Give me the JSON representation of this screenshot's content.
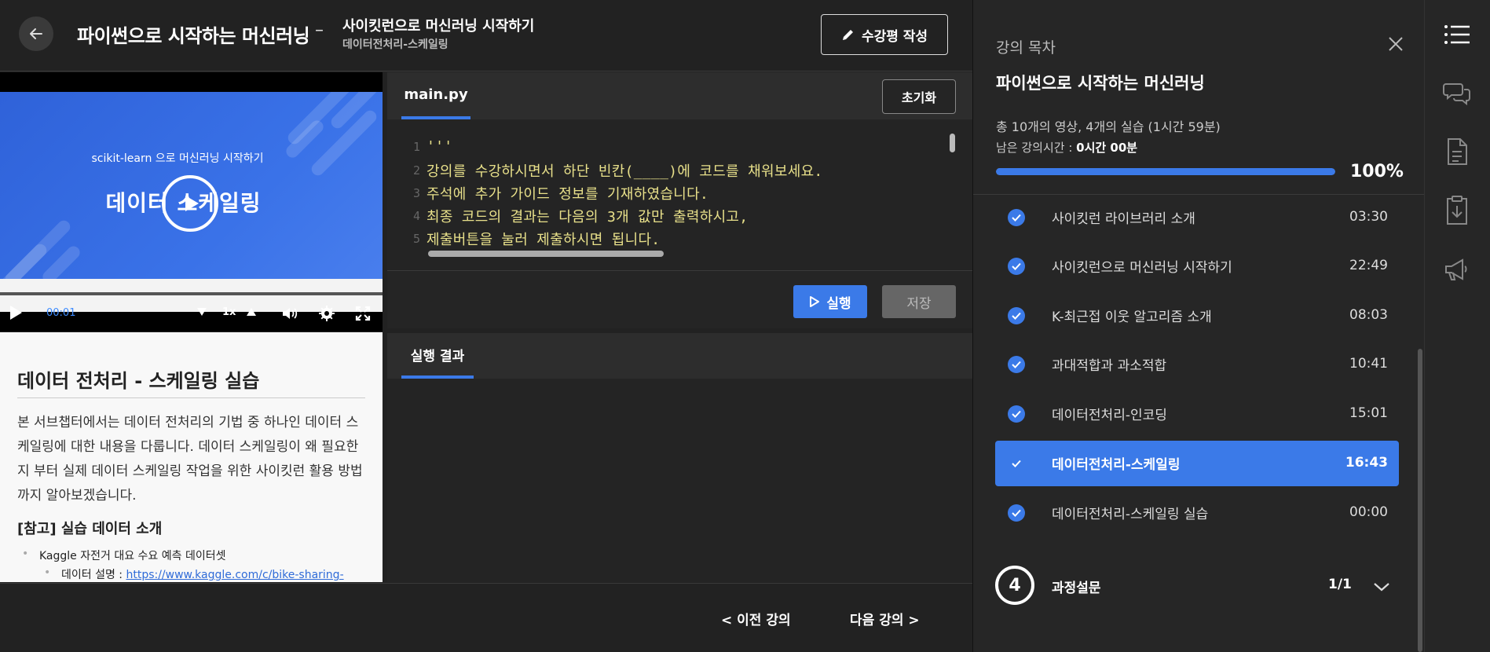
{
  "header": {
    "course_title": "파이썬으로 시작하는 머신러닝",
    "dash": "–",
    "lecture_title": "사이킷런으로 머신러닝 시작하기",
    "lecture_subtitle": "데이터전처리-스케일링",
    "review_label": "수강평 작성"
  },
  "video": {
    "slide_subtitle": "scikit-learn 으로 머신러닝 시작하기",
    "slide_title": "데이터 스케일링",
    "current_time": "00:01",
    "speed": "1x"
  },
  "notes": {
    "heading": "데이터 전처리 - 스케일링 실습",
    "paragraph": "본 서브챕터에서는 데이터 전처리의 기법 중 하나인 데이터 스케일링에 대한 내용을 다룹니다. 데이터 스케일링이 왜 필요한지 부터 실제 데이터 스케일링 작업을 위한 사이킷런 활용 방법까지 알아보겠습니다.",
    "subheading": "[참고] 실습 데이터 소개",
    "bullet": "Kaggle 자전거 대요 수요 예측 데이터셋",
    "sub_bullet_label": "데이터 설명 : ",
    "sub_bullet_link": "https://www.kaggle.com/c/bike-sharing-"
  },
  "editor": {
    "tab": "main.py",
    "reset_label": "초기화",
    "lines": [
      {
        "n": "1",
        "text": "'''"
      },
      {
        "n": "2",
        "text": "강의를 수강하시면서 하단 빈칸(____)에 코드를 채워보세요."
      },
      {
        "n": "3",
        "text": "주석에 추가 가이드 정보를 기재하였습니다."
      },
      {
        "n": "4",
        "text": "최종 코드의 결과는 다음의 3개 값만 출력하시고,"
      },
      {
        "n": "5",
        "text": "제출버튼을 눌러 제출하시면 됩니다."
      }
    ],
    "run_label": "실행",
    "save_label": "저장"
  },
  "result": {
    "tab": "실행 결과"
  },
  "footer": {
    "prev_label": "< 이전 강의",
    "next_label": "다음 강의 >"
  },
  "sidebar": {
    "label": "강의 목차",
    "course_title": "파이썬으로 시작하는 머신러닝",
    "summary": "총 10개의 영상, 4개의 실습 (1시간 59분)",
    "remaining_label": "남은 강의시간 : ",
    "remaining_value": "0시간 00분",
    "progress_percent": 100,
    "progress_text": "100%",
    "lectures": [
      {
        "title": "사이킷런 라이브러리 소개",
        "time": "03:30",
        "active": false
      },
      {
        "title": "사이킷런으로 머신러닝 시작하기",
        "time": "22:49",
        "active": false
      },
      {
        "title": "K-최근접 이웃 알고리즘 소개",
        "time": "08:03",
        "active": false
      },
      {
        "title": "과대적합과 과소적합",
        "time": "10:41",
        "active": false
      },
      {
        "title": "데이터전처리-인코딩",
        "time": "15:01",
        "active": false
      },
      {
        "title": "데이터전처리-스케일링",
        "time": "16:43",
        "active": true
      },
      {
        "title": "데이터전처리-스케일링 실습",
        "time": "00:00",
        "active": false
      }
    ],
    "section": {
      "number": "4",
      "title": "과정설문",
      "count": "1/1"
    }
  },
  "colors": {
    "accent": "#3b7ae8",
    "background": "#222222",
    "code_text": "#e8e08a"
  },
  "rail_icons": [
    "list-icon",
    "chat-icon",
    "document-icon",
    "clipboard-download-icon",
    "megaphone-icon"
  ]
}
